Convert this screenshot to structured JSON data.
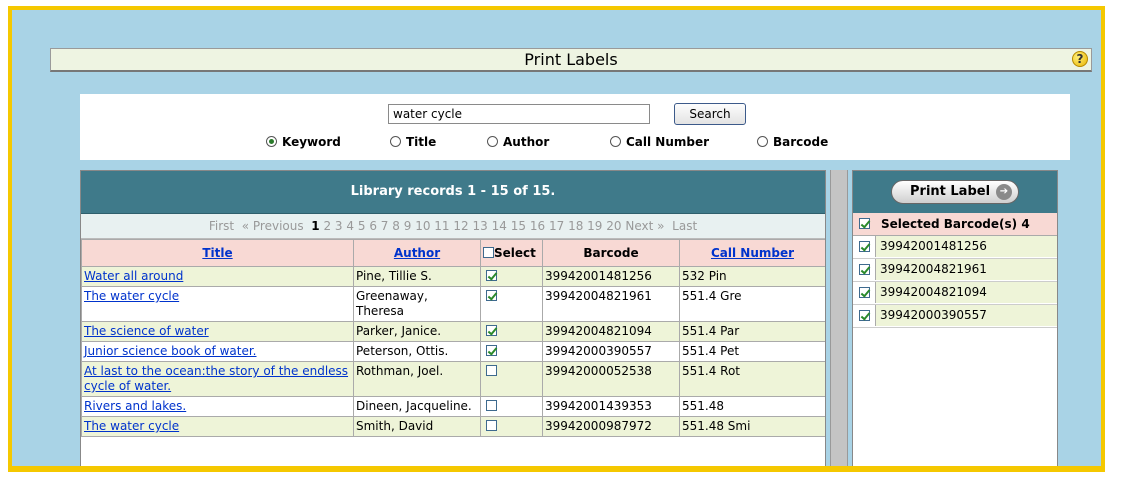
{
  "header": {
    "title": "Print Labels",
    "help_icon": "?"
  },
  "search": {
    "query": "water cycle",
    "button_label": "Search",
    "options": [
      {
        "label": "Keyword",
        "selected": true
      },
      {
        "label": "Title",
        "selected": false
      },
      {
        "label": "Author",
        "selected": false
      },
      {
        "label": "Call Number",
        "selected": false
      },
      {
        "label": "Barcode",
        "selected": false
      }
    ]
  },
  "records": {
    "heading": "Library records 1 - 15 of 15.",
    "pager": {
      "first": "First",
      "previous": "« Previous",
      "current": "1",
      "pages": [
        "2",
        "3",
        "4",
        "5",
        "6",
        "7",
        "8",
        "9",
        "10",
        "11",
        "12",
        "13",
        "14",
        "15",
        "16",
        "17",
        "18",
        "19",
        "20"
      ],
      "next": "Next »",
      "last": "Last"
    },
    "columns": {
      "title": "Title",
      "author": "Author",
      "select": "Select",
      "barcode": "Barcode",
      "call_number": "Call Number"
    },
    "rows": [
      {
        "title": "Water all around",
        "author": "Pine, Tillie S.",
        "selected": true,
        "barcode": "39942001481256",
        "call": "532 Pin"
      },
      {
        "title": "The water cycle",
        "author": "Greenaway, Theresa",
        "selected": true,
        "barcode": "39942004821961",
        "call": "551.4 Gre"
      },
      {
        "title": "The science of water",
        "author": "Parker, Janice.",
        "selected": true,
        "barcode": "39942004821094",
        "call": "551.4 Par"
      },
      {
        "title": "Junior science book of water.",
        "author": "Peterson, Ottis.",
        "selected": true,
        "barcode": "39942000390557",
        "call": "551.4 Pet"
      },
      {
        "title": "At last to the ocean:the story of the endless cycle of water.",
        "author": "Rothman, Joel.",
        "selected": false,
        "barcode": "39942000052538",
        "call": "551.4 Rot"
      },
      {
        "title": "Rivers and lakes.",
        "author": "Dineen, Jacqueline.",
        "selected": false,
        "barcode": "39942001439353",
        "call": "551.48"
      },
      {
        "title": "The water cycle",
        "author": "Smith, David",
        "selected": false,
        "barcode": "39942000987972",
        "call": "551.48 Smi"
      }
    ]
  },
  "selected_panel": {
    "print_button": "Print Label",
    "title": "Selected Barcode(s) 4",
    "barcodes": [
      "39942001481256",
      "39942004821961",
      "39942004821094",
      "39942000390557"
    ]
  },
  "colors": {
    "frame": "#f5c800",
    "background": "#a9d3e6",
    "panel_header": "#3f7a8a",
    "link": "#0033cc",
    "row_alt": "#eef4d8",
    "col_header": "#f8d9d4"
  }
}
